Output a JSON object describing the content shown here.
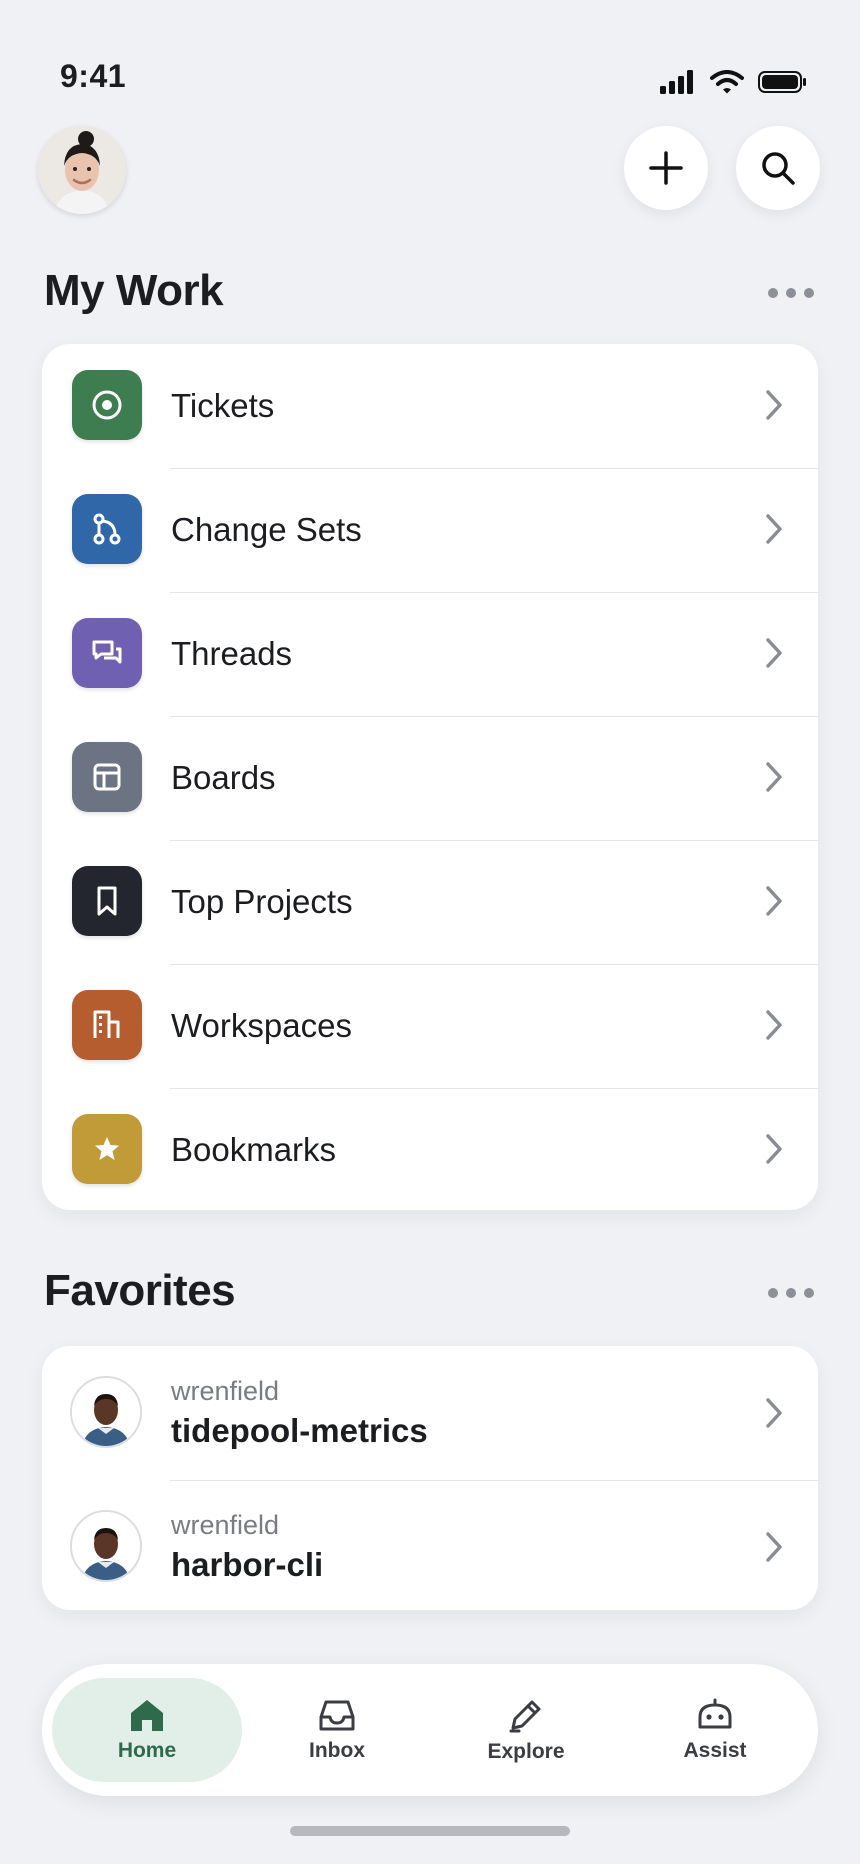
{
  "status": {
    "time": "9:41"
  },
  "my_work": {
    "title": "My Work",
    "items": [
      {
        "label": "Tickets",
        "icon": "target-icon",
        "color": "#3d7d4f"
      },
      {
        "label": "Change Sets",
        "icon": "branch-merge-icon",
        "color": "#2f67a9"
      },
      {
        "label": "Threads",
        "icon": "chat-bubbles-icon",
        "color": "#7060b2"
      },
      {
        "label": "Boards",
        "icon": "board-layout-icon",
        "color": "#6c7382"
      },
      {
        "label": "Top Projects",
        "icon": "bookmark-icon",
        "color": "#23262e"
      },
      {
        "label": "Workspaces",
        "icon": "building-icon",
        "color": "#b65d2f"
      },
      {
        "label": "Bookmarks",
        "icon": "star-icon",
        "color": "#c19b38"
      }
    ]
  },
  "favorites": {
    "title": "Favorites",
    "items": [
      {
        "owner": "wrenfield",
        "name": "tidepool-metrics"
      },
      {
        "owner": "wrenfield",
        "name": "harbor-cli"
      }
    ]
  },
  "tabbar": {
    "tabs": [
      {
        "label": "Home",
        "icon": "home-icon",
        "active": true
      },
      {
        "label": "Inbox",
        "icon": "inbox-tray-icon",
        "active": false
      },
      {
        "label": "Explore",
        "icon": "pen-icon",
        "active": false
      },
      {
        "label": "Assist",
        "icon": "robot-icon",
        "active": false
      }
    ]
  }
}
